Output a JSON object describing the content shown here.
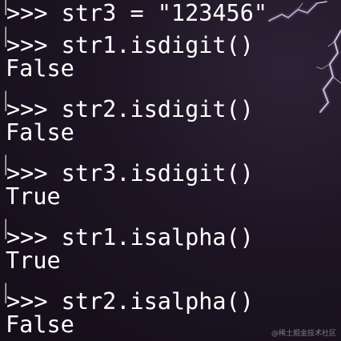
{
  "terminal": {
    "prompt": ">>>",
    "bracket": "[",
    "lines": [
      {
        "kind": "input",
        "text": "str3 = \"123456\""
      },
      {
        "kind": "input",
        "text": "str1.isdigit()"
      },
      {
        "kind": "output",
        "text": "False"
      },
      {
        "kind": "input",
        "text": "str2.isdigit()"
      },
      {
        "kind": "output",
        "text": "False"
      },
      {
        "kind": "input",
        "text": "str3.isdigit()"
      },
      {
        "kind": "output",
        "text": "True"
      },
      {
        "kind": "input",
        "text": "str1.isalpha()"
      },
      {
        "kind": "output",
        "text": "True"
      },
      {
        "kind": "input",
        "text": "str2.isalpha()"
      },
      {
        "kind": "output",
        "text": "False"
      }
    ]
  },
  "watermark": "@稀土掘金技术社区",
  "colors": {
    "background": "#1d1524",
    "text": "#ffffff",
    "lightning": "#e8e0f5"
  }
}
